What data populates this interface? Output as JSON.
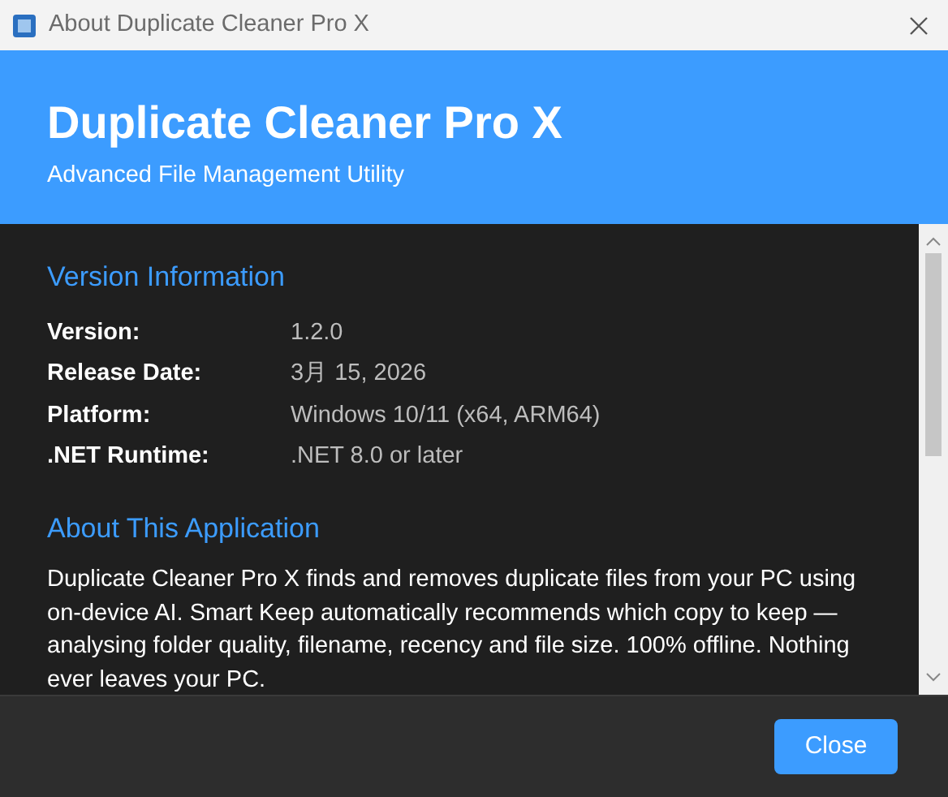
{
  "window": {
    "title": "About Duplicate Cleaner Pro X"
  },
  "header": {
    "title": "Duplicate Cleaner Pro X",
    "subtitle": "Advanced File Management Utility"
  },
  "version_section": {
    "heading": "Version Information",
    "rows": [
      {
        "label": "Version:",
        "value": "1.2.0"
      },
      {
        "label": "Release Date:",
        "value": "3月 15, 2026"
      },
      {
        "label": "Platform:",
        "value": "Windows 10/11 (x64, ARM64)"
      },
      {
        "label": ".NET Runtime:",
        "value": ".NET 8.0 or later"
      }
    ]
  },
  "about_section": {
    "heading": "About This Application",
    "text": "Duplicate Cleaner Pro X finds and removes duplicate files from your PC using on-device AI. Smart Keep automatically recommends which copy to keep — analysing folder quality, filename, recency and file size. 100% offline. Nothing ever leaves your PC."
  },
  "buttons": [
    "Close"
  ]
}
